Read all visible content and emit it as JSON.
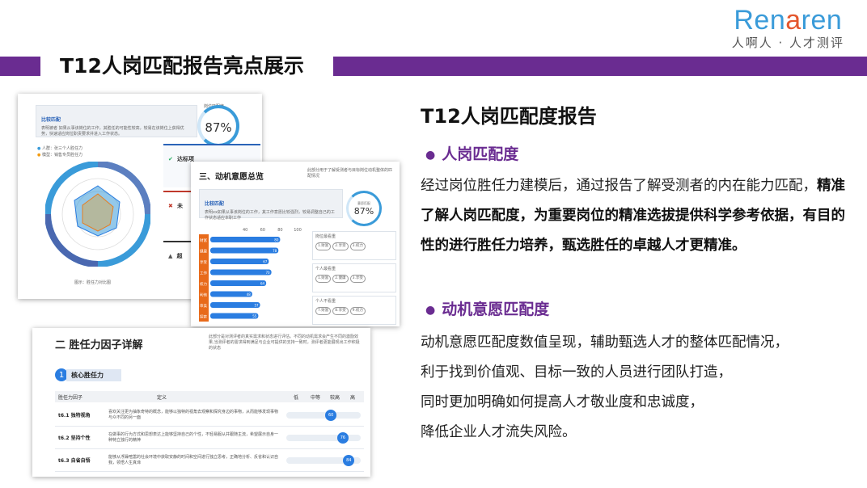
{
  "logo": {
    "word_a": "Ren",
    "word_b": "a",
    "word_c": "ren",
    "tagline": "人啊人 · 人才测评"
  },
  "slide_title": "T12人岗匹配报告亮点展示",
  "content": {
    "heading": "T12人岗匹配度报告",
    "section1": {
      "bullet": "人岗匹配度",
      "text_a": "经过岗位胜任力建模后，通过报告了解受测者的内在能力匹配，",
      "text_b": "精准了解人岗匹配度，为重要岗位的精准选拔提供科学参考依据，有目的性的进行胜任力培养，甄选胜任的卓越人才更精准。"
    },
    "section2": {
      "bullet": "动机意愿匹配度",
      "lines": [
        "动机意愿匹配度数值呈现，辅助甄选人才的整体匹配情况，",
        "利于找到价值观、目标一致的人员进行团队打造，",
        "同时更加明确如何提高人才敬业度和忠诚度，",
        "降低企业人才流失风险。"
      ]
    }
  },
  "thumb1": {
    "label": "比较匹配",
    "desc": "表明被者 如果从事该岗位的工作，其胜任的可能性较高，较易在该岗位上获得优势，快速适应岗位职责要求并进入工作状态。",
    "score_label": "岗位匹配度",
    "score": "87%",
    "legend": [
      "人群：张三个人胜任力",
      "模型：销售专员胜任力"
    ],
    "caption": "图示：胜任力对比图",
    "reached": "达标项",
    "not_reached": "未",
    "exceed": "超"
  },
  "thumb2": {
    "title": "三、动机意愿总览",
    "note": "此部分用于了解受测者与目标岗位动机整体的匹配情况",
    "label": "比较匹配",
    "desc": "表明xx如果从事该岗位的工作，其工作意愿比较强烈，较易调整自己的工作状态适应本职工作",
    "score_label": "意愿匹配",
    "score": "87%",
    "axis": [
      "40",
      "60",
      "80",
      "100"
    ],
    "groups": [
      "岗位最看重",
      "个人最看重",
      "个人不看重"
    ],
    "tags": [
      [
        "1.财富",
        "2.享受",
        "3.权力"
      ],
      [
        "1.财富",
        "2.健康",
        "3.享受"
      ],
      [
        "7.财富",
        "8.享受",
        "9.权力"
      ]
    ]
  },
  "chart_data": {
    "type": "bar",
    "categories": [
      "财富",
      "健康",
      "享受",
      "工作",
      "权力",
      "利他",
      "审美",
      "探索"
    ],
    "values": [
      80,
      78,
      67,
      70,
      64,
      48,
      57,
      55
    ],
    "xlim": [
      0,
      100
    ]
  },
  "thumb3": {
    "title": "二 胜任力因子详解",
    "note": "此部分是对测评者的真实需求和状态进行评估。不同的动机需求会产生不同的激励效果,当测评者的需求得到满足与企业可提供的支持一致时，测评者更能展现出工作积极的状态",
    "section_no": "1",
    "section": "核心胜任力",
    "headers": [
      "胜任力因子",
      "定义",
      "低",
      "中等",
      "较高",
      "高"
    ],
    "rows": [
      {
        "name": "t6.1 独特视角",
        "def": "喜欢关注更为抽象奇特的概念，能够以独特的视角去观察和探究身边的事物，从而能够发现事物与众不同的另一面",
        "value": 60
      },
      {
        "name": "t6.2 坚持个性",
        "def": "在做事的行为方式和思想表达上能够坚持自己的个性，不轻易服从并跟随主流，希望展示自身一种特立独行的精神",
        "value": 76
      },
      {
        "name": "t6.3 自省自悟",
        "def": "能够从浮躁喧嚣的社会环境中获取安静的时间和空间进行独立思考，正确地分析、反省和认识自我，领悟人生真谛",
        "value": 84
      }
    ]
  },
  "colors": {
    "brand_purple": "#6a2c91",
    "logo_blue": "#3a9bd9",
    "accent_orange": "#e86a1a",
    "bar_blue": "#2a7de1"
  }
}
